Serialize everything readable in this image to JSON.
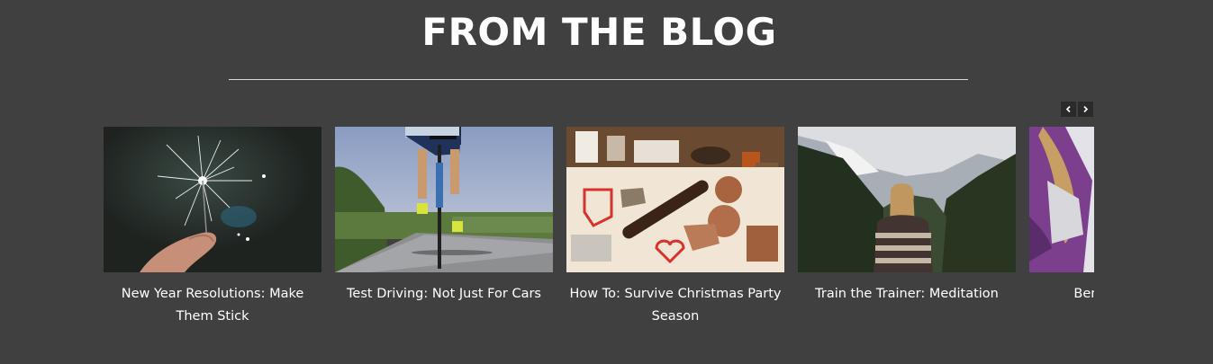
{
  "section": {
    "title": "FROM THE BLOG"
  },
  "carousel": {
    "prev_icon": "chevron-left-icon",
    "next_icon": "chevron-right-icon",
    "posts": [
      {
        "title": "New Year Resolutions: Make Them Stick",
        "image": "sparkler-photo"
      },
      {
        "title": "Test Driving: Not Just For Cars",
        "image": "cyclist-photo"
      },
      {
        "title": "How To: Survive Christmas Party Season",
        "image": "cookie-baking-photo"
      },
      {
        "title": "Train the Trainer: Meditation",
        "image": "mountain-valley-photo"
      },
      {
        "title": "Benefits of ... the ...",
        "image": "woman-purple-jacket-photo"
      }
    ]
  },
  "colors": {
    "background": "#404040",
    "text": "#ffffff",
    "divider": "#d9d9d9",
    "nav_button": "#2a2a2a"
  }
}
